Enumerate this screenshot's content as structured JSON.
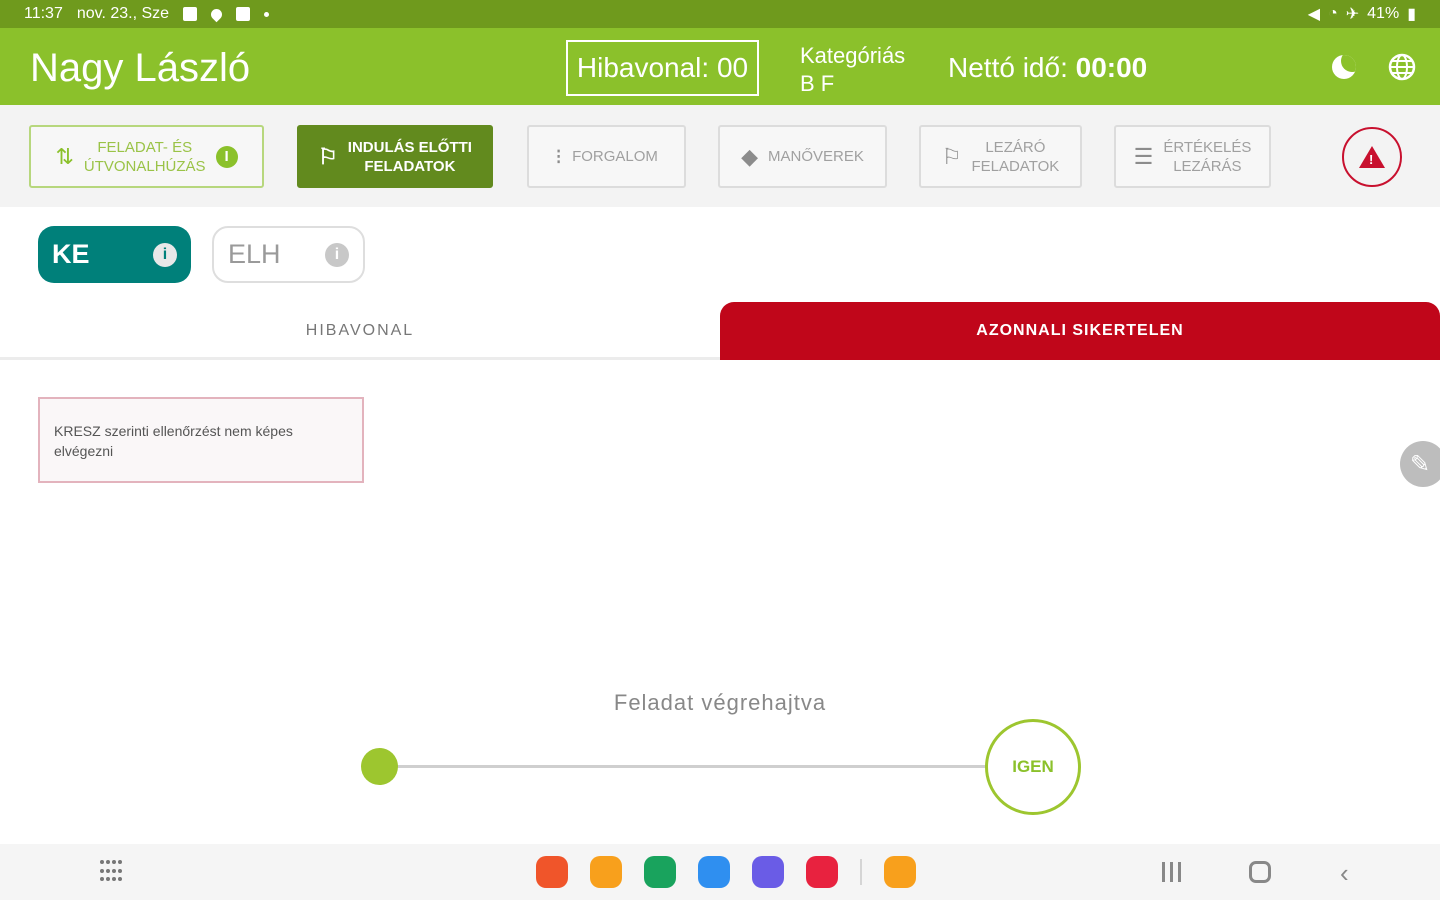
{
  "status_bar": {
    "time": "11:37",
    "date": "nov. 23., Sze",
    "battery": "41%"
  },
  "header": {
    "name": "Nagy László",
    "fault_label": "Hibavonal: 00",
    "category_label": "Kategóriás",
    "category_value": "B F",
    "net_time_label": "Nettó idő:",
    "net_time_value": "00:00"
  },
  "toolbar": {
    "buttons": [
      {
        "line1": "FELADAT- ÉS",
        "line2": "ÚTVONALHÚZÁS",
        "icon": "route-check-icon",
        "state": "done"
      },
      {
        "line1": "INDULÁS ELŐTTI",
        "line2": "FELADATOK",
        "icon": "flag-icon",
        "state": "active"
      },
      {
        "line1": "FORGALOM",
        "line2": "",
        "icon": "traffic-light-icon",
        "state": "inactive"
      },
      {
        "line1": "MANŐVEREK",
        "line2": "",
        "icon": "diamond-sign-icon",
        "state": "inactive"
      },
      {
        "line1": "LEZÁRÓ",
        "line2": "FELADATOK",
        "icon": "flag-icon",
        "state": "inactive"
      },
      {
        "line1": "ÉRTÉKELÉS",
        "line2": "LEZÁRÁS",
        "icon": "checklist-icon",
        "state": "inactive"
      }
    ]
  },
  "chips": [
    {
      "label": "KE",
      "selected": true
    },
    {
      "label": "ELH",
      "selected": false
    }
  ],
  "tabs": [
    {
      "label": "HIBAVONAL",
      "active": false
    },
    {
      "label": "AZONNALI SIKERTELEN",
      "active": true
    }
  ],
  "card_text": "KRESZ szerinti ellenőrzést nem képes elvégezni",
  "slider": {
    "label": "Feladat végrehajtva",
    "end_label": "IGEN",
    "value": 0
  },
  "colors": {
    "header_green": "#8bc12b",
    "status_green": "#6f9a1d",
    "active_green": "#628a1e",
    "teal": "#00807a",
    "red": "#c0061a"
  },
  "dock_apps": [
    {
      "icon": "app-orange-red-icon",
      "color": "#f0552a"
    },
    {
      "icon": "app-folder-icon",
      "color": "#f8a01c"
    },
    {
      "icon": "app-phone-icon",
      "color": "#19a35d"
    },
    {
      "icon": "app-messages-icon",
      "color": "#2f8ff0"
    },
    {
      "icon": "app-internet-icon",
      "color": "#6a5ce6"
    },
    {
      "icon": "app-screen-recorder-icon",
      "color": "#e8223f"
    },
    {
      "icon": "app-notes-icon",
      "color": "#f8a01c"
    }
  ]
}
